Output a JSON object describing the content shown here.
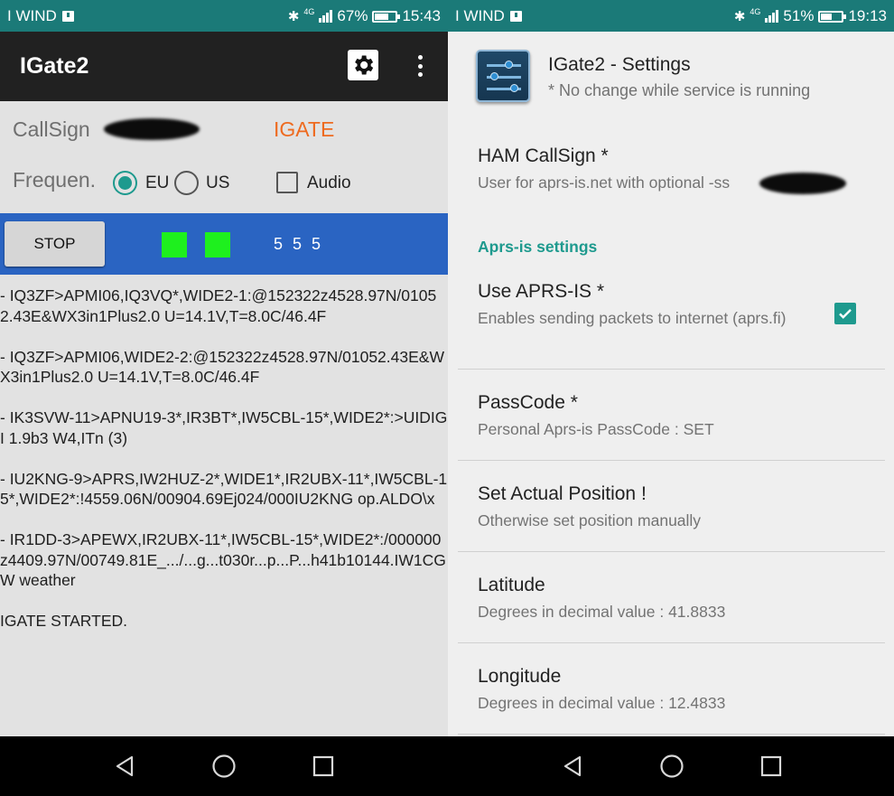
{
  "left_screen": {
    "status_bar": {
      "carrier": "I WIND",
      "network": "4G",
      "battery": "67%",
      "battery_level": 0.67,
      "time": "15:43"
    },
    "app_bar": {
      "title": "IGate2",
      "settings_icon": "gear-icon",
      "menu_icon": "more-vert-icon"
    },
    "callsign_label": "CallSign",
    "status_label": "IGATE",
    "frequency_label": "Frequen.",
    "freq_options": [
      {
        "label": "EU",
        "selected": true
      },
      {
        "label": "US",
        "selected": false
      }
    ],
    "audio": {
      "label": "Audio",
      "checked": false
    },
    "stop_button": "STOP",
    "indicators": [
      {
        "color": "#1ef01e"
      },
      {
        "color": "#1ef01e"
      }
    ],
    "counter": "5 5 5",
    "log": [
      "- IQ3ZF>APMI06,IQ3VQ*,WIDE2-1:@152322z4528.97N/01052.43E&WX3in1Plus2.0 U=14.1V,T=8.0C/46.4F",
      "- IQ3ZF>APMI06,WIDE2-2:@152322z4528.97N/01052.43E&WX3in1Plus2.0 U=14.1V,T=8.0C/46.4F",
      "- IK3SVW-11>APNU19-3*,IR3BT*,IW5CBL-15*,WIDE2*:>UIDIGI 1.9b3 W4,ITn (3)",
      "- IU2KNG-9>APRS,IW2HUZ-2*,WIDE1*,IR2UBX-11*,IW5CBL-15*,WIDE2*:!4559.06N/00904.69Ej024/000IU2KNG op.ALDO\\x",
      "- IR1DD-3>APEWX,IR2UBX-11*,IW5CBL-15*,WIDE2*:/000000z4409.97N/00749.81E_.../...g...t030r...p...P...h41b10144.IW1CGW weather",
      "IGATE STARTED."
    ]
  },
  "right_screen": {
    "status_bar": {
      "carrier": "I WIND",
      "network": "4G",
      "battery": "51%",
      "battery_level": 0.51,
      "time": "19:13"
    },
    "header": {
      "title": "IGate2 - Settings",
      "subtitle": "* No change while service is running",
      "icon": "settings-sliders-icon"
    },
    "callsign_pref": {
      "title": "HAM CallSign *",
      "summary": "User for aprs-is.net with optional -ss"
    },
    "category": "Aprs-is settings",
    "prefs": [
      {
        "title": "Use APRS-IS *",
        "summary": "Enables sending packets to internet (aprs.fi)",
        "checked": true
      },
      {
        "title": "PassCode *",
        "summary": "Personal Aprs-is PassCode : SET"
      },
      {
        "title": "Set Actual Position !",
        "summary": "Otherwise set position manually"
      },
      {
        "title": "Latitude",
        "summary": "Degrees in decimal value : 41.8833"
      },
      {
        "title": "Longitude",
        "summary": "Degrees in decimal value : 12.4833"
      }
    ]
  },
  "nav_bar": {
    "icons": [
      "back-icon",
      "home-icon",
      "recents-icon"
    ]
  },
  "colors": {
    "status_bar": "#1b7a78",
    "accent": "#1e9a8e",
    "igate_status": "#ee6a1f",
    "control_bar": "#2a64c2",
    "app_bar": "#212121"
  }
}
